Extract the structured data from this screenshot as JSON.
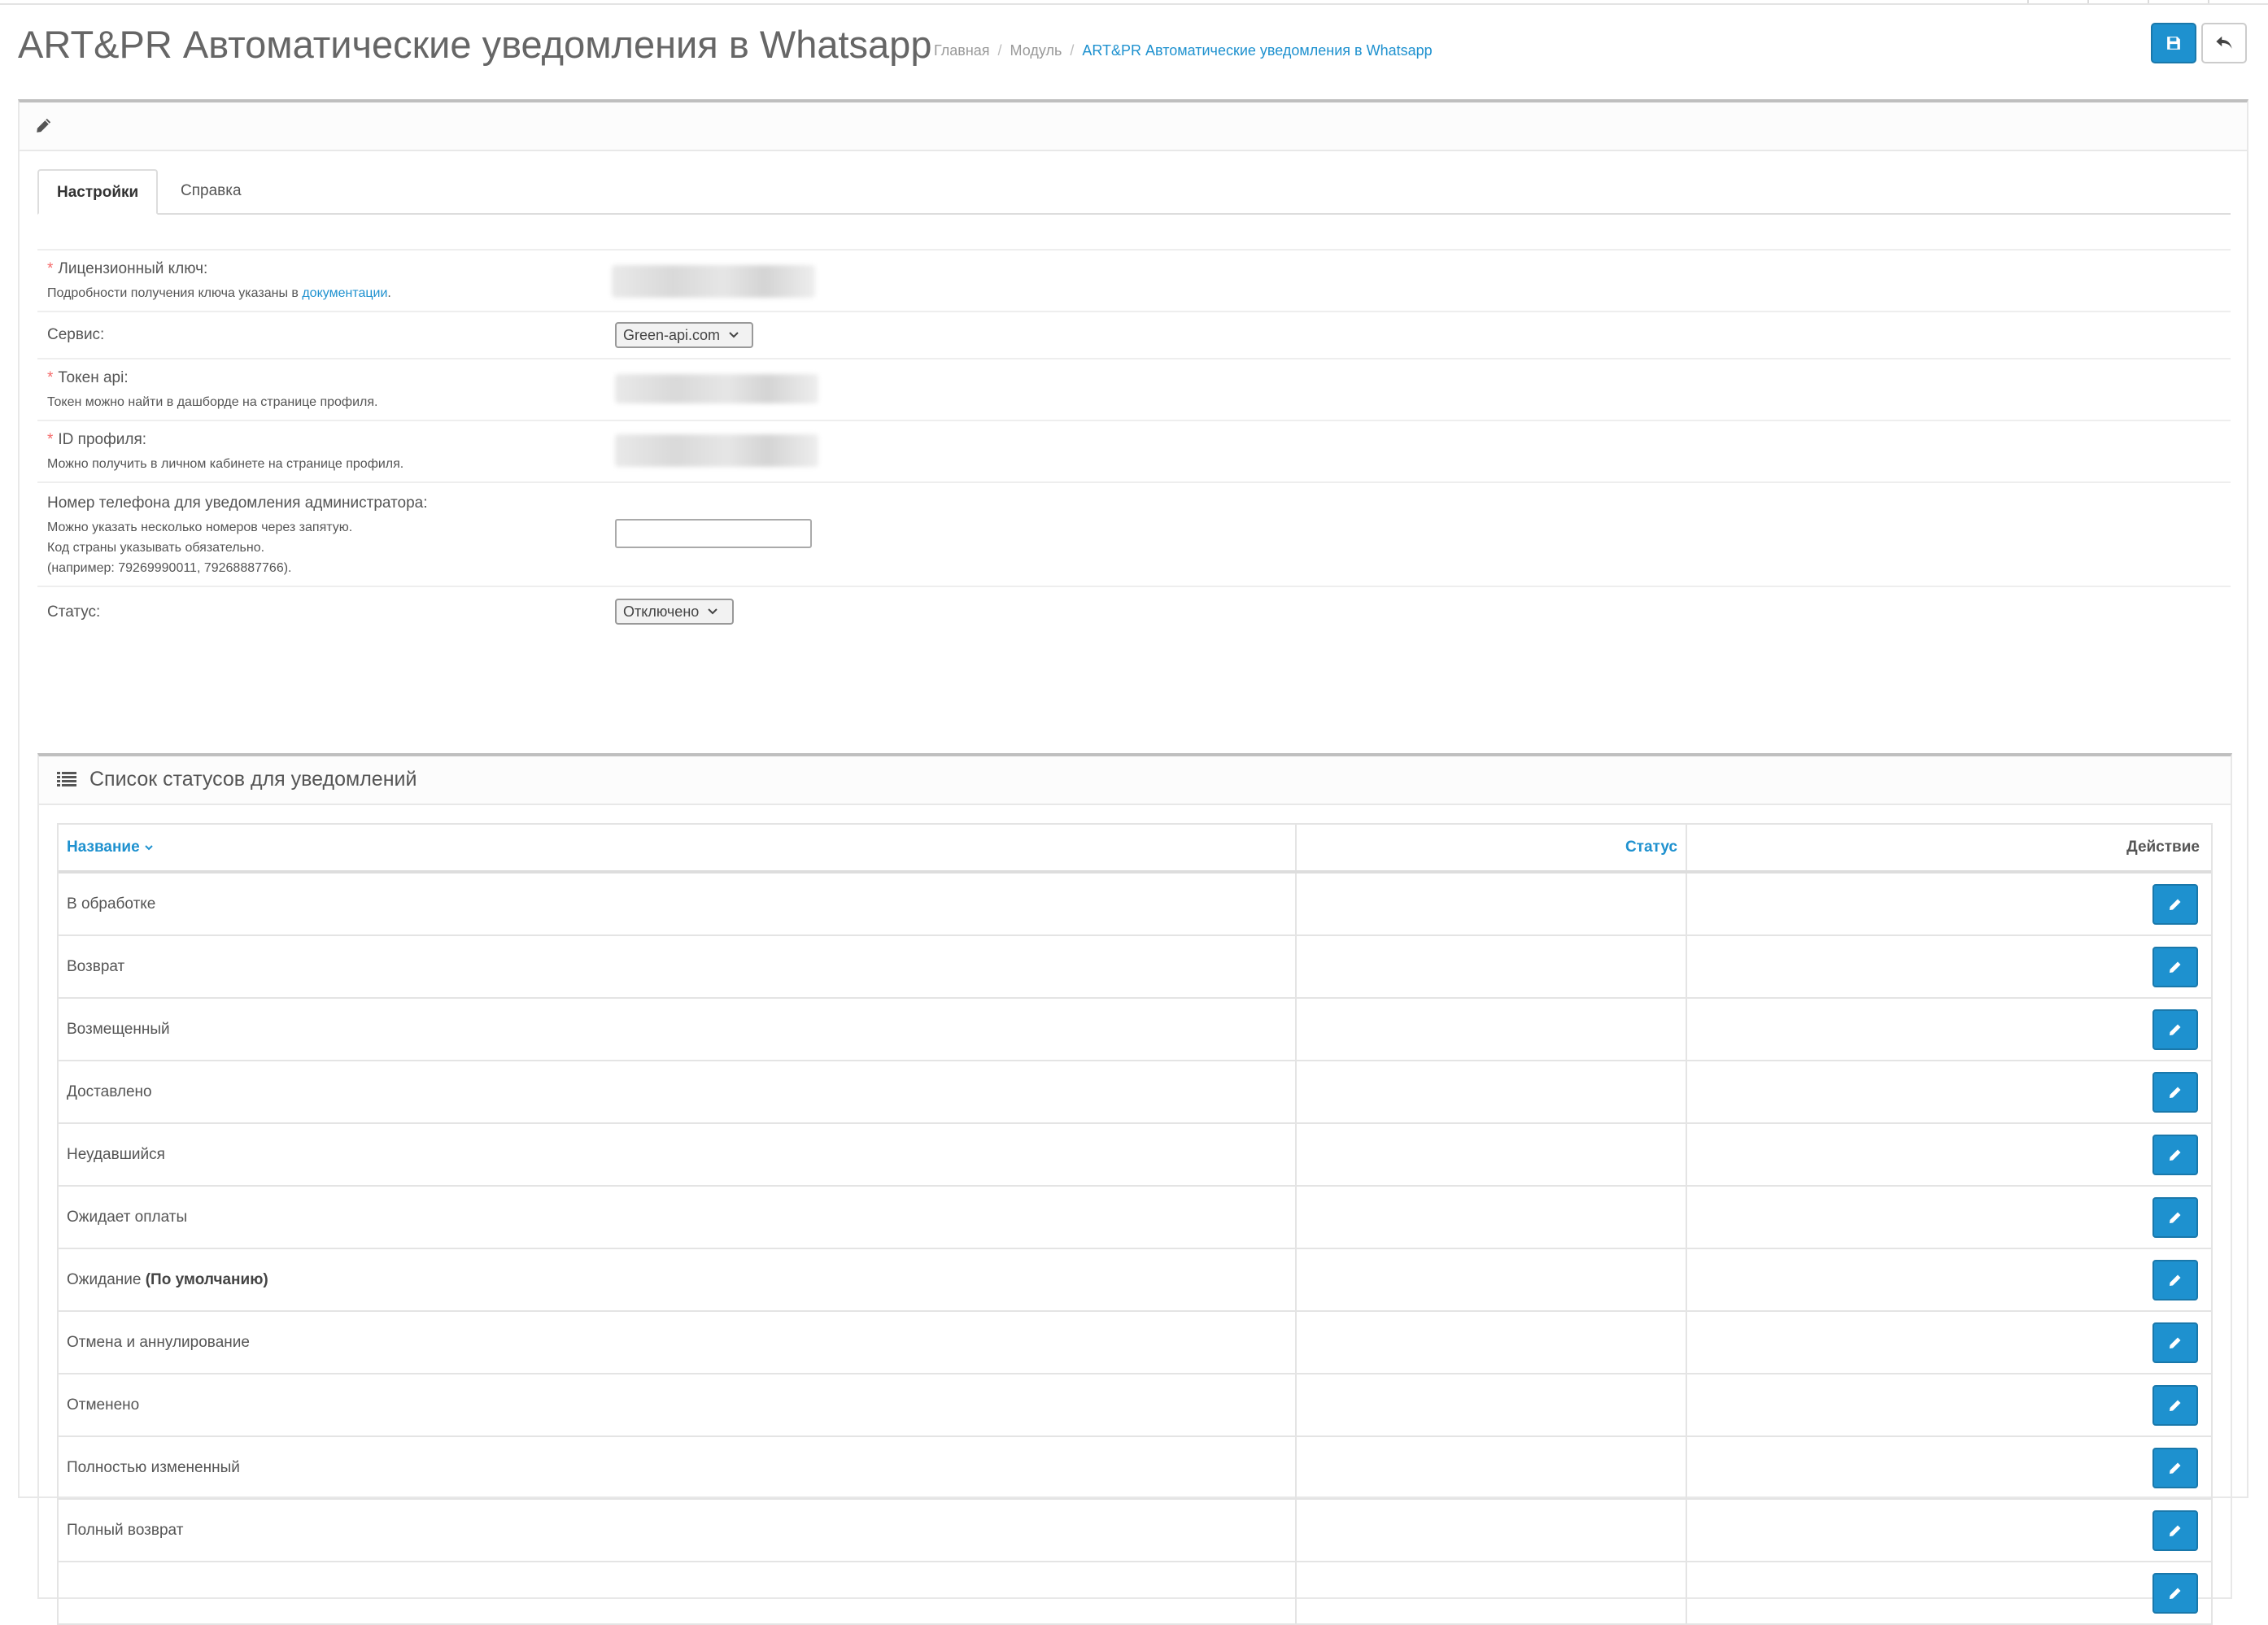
{
  "header": {
    "title": "ART&PR Автоматические уведомления в Whatsapp",
    "breadcrumb": [
      "Главная",
      "Модуль",
      "ART&PR Автоматические уведомления в Whatsapp"
    ],
    "breadcrumb_sep": "/"
  },
  "tabs": [
    {
      "label": "Настройки",
      "active": true
    },
    {
      "label": "Справка",
      "active": false
    }
  ],
  "form": {
    "license": {
      "label": "Лицензионный ключ:",
      "help_prefix": "Подробности получения ключа указаны в ",
      "help_link": "документации",
      "help_suffix": "."
    },
    "service": {
      "label": "Сервис:",
      "value": "Green-api.com"
    },
    "token": {
      "label": "Токен api:",
      "help": "Токен можно найти в дашборде на странице профиля."
    },
    "profile_id": {
      "label": "ID профиля:",
      "help": "Можно получить в личном кабинете на странице профиля."
    },
    "phone": {
      "label": "Номер телефона для уведомления администратора:",
      "help": [
        "Можно указать несколько номеров через запятую.",
        "Код страны указывать обязательно.",
        "(например: 79269990011, 79268887766)."
      ],
      "value": ""
    },
    "status": {
      "label": "Статус:",
      "value": "Отключено"
    },
    "required_mark": "*"
  },
  "status_list": {
    "title": "Список статусов для уведомлений",
    "columns": {
      "name": "Название",
      "status": "Статус",
      "action": "Действие"
    },
    "rows": [
      {
        "name": "В обработке",
        "suffix": ""
      },
      {
        "name": "Возврат",
        "suffix": ""
      },
      {
        "name": "Возмещенный",
        "suffix": ""
      },
      {
        "name": "Доставлено",
        "suffix": ""
      },
      {
        "name": "Неудавшийся",
        "suffix": ""
      },
      {
        "name": "Ожидает оплаты",
        "suffix": ""
      },
      {
        "name": "Ожидание",
        "suffix": "(По умолчанию)"
      },
      {
        "name": "Отмена и аннулирование",
        "suffix": ""
      },
      {
        "name": "Отменено",
        "suffix": ""
      },
      {
        "name": "Полностью измененный",
        "suffix": ""
      },
      {
        "name": "Полный возврат",
        "suffix": ""
      },
      {
        "name": "",
        "suffix": ""
      }
    ]
  },
  "colors": {
    "primary": "#1e91cf",
    "required": "#f56b6b",
    "text": "#555555"
  },
  "icons": {
    "save": "floppy-disk-icon",
    "back": "reply-arrow-icon",
    "edit": "pencil-icon",
    "list": "list-icon",
    "sort": "chevron-down-icon",
    "select": "chevron-down-icon"
  }
}
